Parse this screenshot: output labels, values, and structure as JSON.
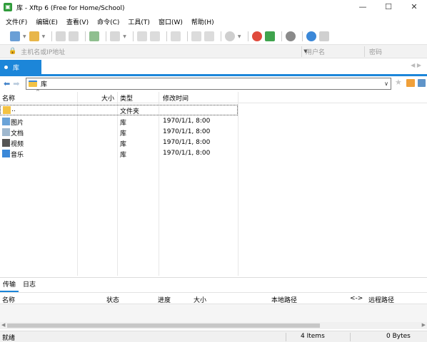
{
  "window": {
    "title": "库 - Xftp 6 (Free for Home/School)",
    "controls": {
      "minimize": "—",
      "maximize": "☐",
      "close": "✕"
    }
  },
  "menu": [
    "文件(F)",
    "编辑(E)",
    "查看(V)",
    "命令(C)",
    "工具(T)",
    "窗口(W)",
    "帮助(H)"
  ],
  "address_bar": {
    "host_placeholder": "主机名或IP地址",
    "user_placeholder": "用户名",
    "password_placeholder": "密码"
  },
  "tabs": [
    {
      "label": "库",
      "active": true
    }
  ],
  "path": {
    "value": "库"
  },
  "file_list": {
    "columns": [
      "名称",
      "大小",
      "类型",
      "修改时间"
    ],
    "rows": [
      {
        "name": "..",
        "size": "",
        "type": "文件夹",
        "modified": "",
        "icon": "parent-folder-icon"
      },
      {
        "name": "图片",
        "size": "",
        "type": "库",
        "modified": "1970/1/1, 8:00",
        "icon": "pictures-icon"
      },
      {
        "name": "文档",
        "size": "",
        "type": "库",
        "modified": "1970/1/1, 8:00",
        "icon": "documents-icon"
      },
      {
        "name": "视频",
        "size": "",
        "type": "库",
        "modified": "1970/1/1, 8:00",
        "icon": "videos-icon"
      },
      {
        "name": "音乐",
        "size": "",
        "type": "库",
        "modified": "1970/1/1, 8:00",
        "icon": "music-icon"
      }
    ]
  },
  "bottom_tabs": [
    {
      "label": "传输",
      "active": true
    },
    {
      "label": "日志",
      "active": false
    }
  ],
  "transfer_columns": [
    "名称",
    "状态",
    "进度",
    "大小",
    "本地路径",
    "<->",
    "远程路径"
  ],
  "status": {
    "left": "就绪",
    "count": "4 Items",
    "size": "0 Bytes"
  },
  "colors": {
    "accent": "#1c86d9",
    "folder": "#f3c244"
  }
}
